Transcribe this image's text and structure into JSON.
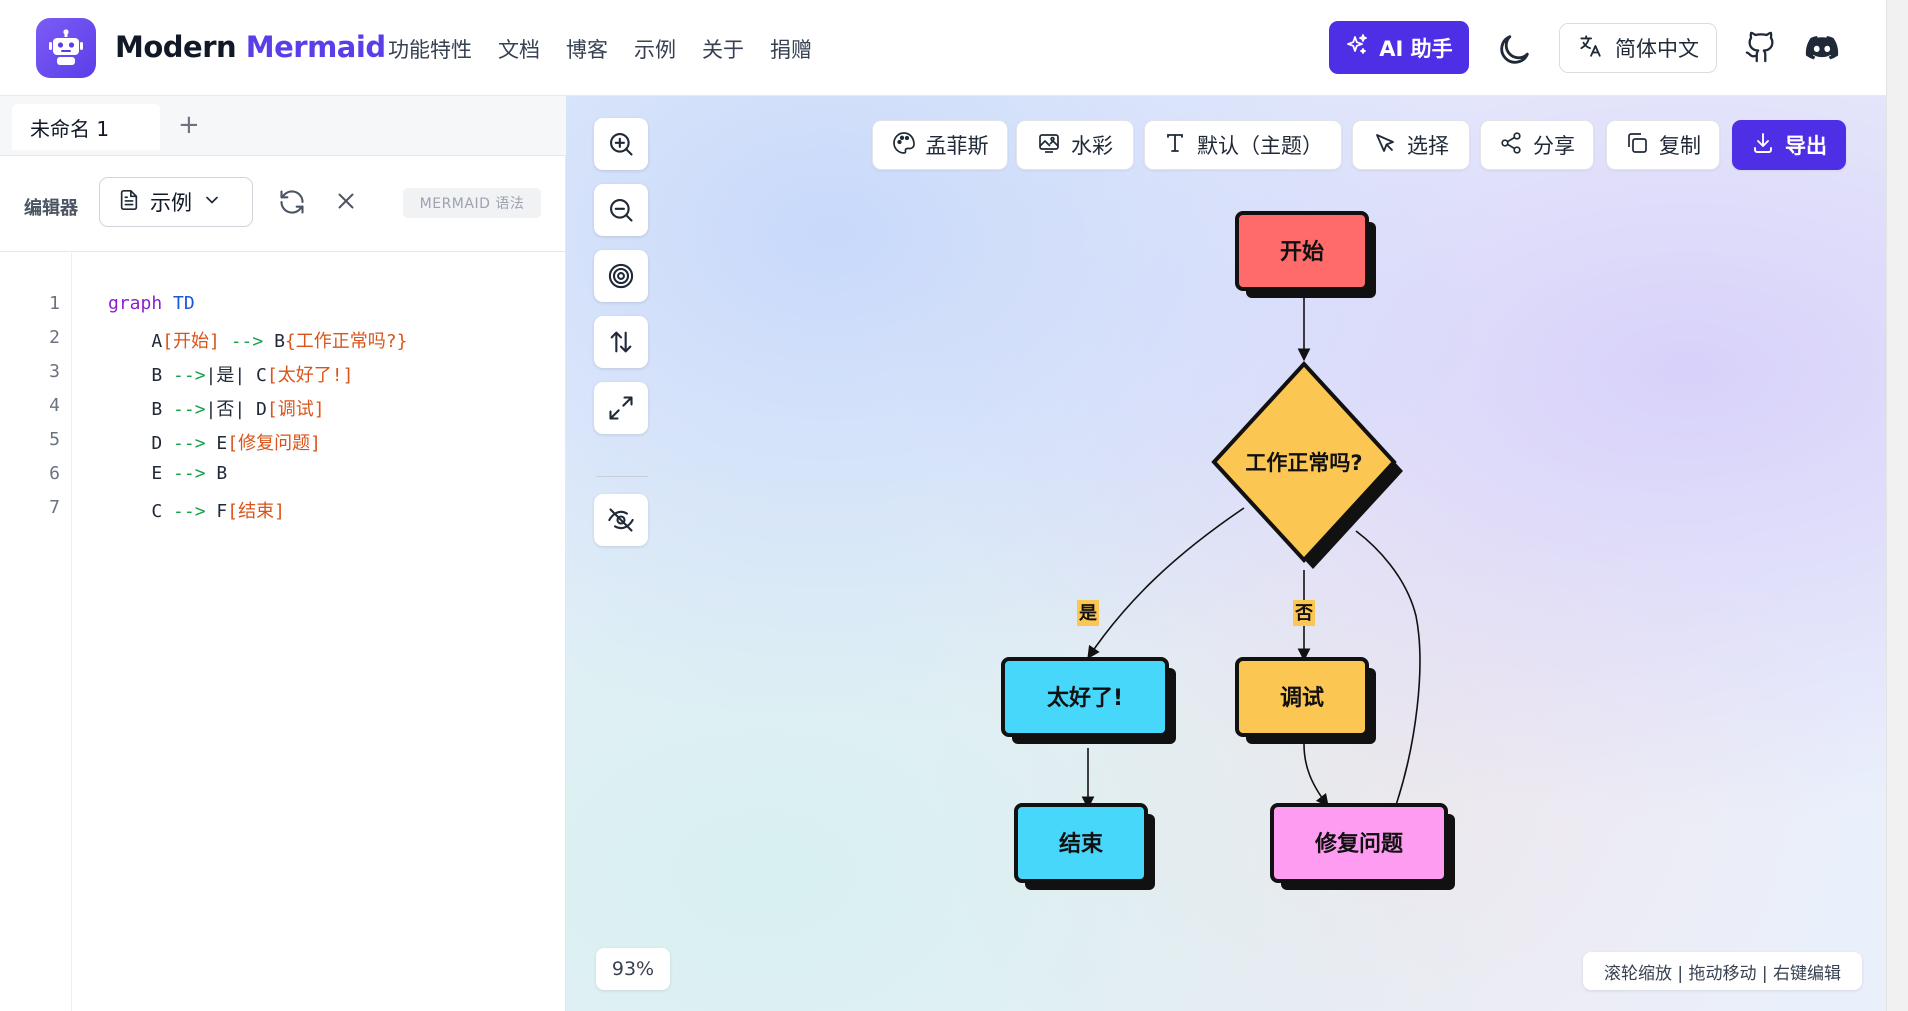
{
  "header": {
    "brand_part1": "Modern",
    "brand_part2": "Mermaid",
    "nav": [
      "功能特性",
      "文档",
      "博客",
      "示例",
      "关于",
      "捐赠"
    ],
    "ai_button": "AI 助手",
    "language_button": "简体中文",
    "icons": [
      "robot-logo-icon",
      "sparkles-icon",
      "moon-icon",
      "translate-icon",
      "github-icon",
      "discord-icon"
    ]
  },
  "editor": {
    "tab_label": "未命名 1",
    "add_tab": "+",
    "label": "编辑器",
    "example_select": "示例",
    "syntax_badge": "MERMAID 语法",
    "line_numbers": [
      "1",
      "2",
      "3",
      "4",
      "5",
      "6",
      "7"
    ],
    "code": [
      [
        {
          "t": "graph",
          "c": "kw"
        },
        {
          "t": " "
        },
        {
          "t": "TD",
          "c": "kw2"
        }
      ],
      [
        {
          "t": "    A"
        },
        {
          "t": "[开始]",
          "c": "str"
        },
        {
          "t": " "
        },
        {
          "t": "-->",
          "c": "arr"
        },
        {
          "t": " B"
        },
        {
          "t": "{工作正常吗?}",
          "c": "str"
        }
      ],
      [
        {
          "t": "    B "
        },
        {
          "t": "-->",
          "c": "arr"
        },
        {
          "t": "|是| C"
        },
        {
          "t": "[太好了!]",
          "c": "str"
        }
      ],
      [
        {
          "t": "    B "
        },
        {
          "t": "-->",
          "c": "arr"
        },
        {
          "t": "|否| D"
        },
        {
          "t": "[调试]",
          "c": "str"
        }
      ],
      [
        {
          "t": "    D "
        },
        {
          "t": "-->",
          "c": "arr"
        },
        {
          "t": " E"
        },
        {
          "t": "[修复问题]",
          "c": "str"
        }
      ],
      [
        {
          "t": "    E "
        },
        {
          "t": "-->",
          "c": "arr"
        },
        {
          "t": " B"
        }
      ],
      [
        {
          "t": "    C "
        },
        {
          "t": "-->",
          "c": "arr"
        },
        {
          "t": " F"
        },
        {
          "t": "[结束]",
          "c": "str"
        }
      ]
    ]
  },
  "canvas": {
    "toolbar": {
      "style_button": "孟菲斯",
      "watermark_button": "水彩",
      "font_button": "默认（主题）",
      "select_button": "选择",
      "share_button": "分享",
      "copy_button": "复制",
      "export_button": "导出"
    },
    "side_tools": [
      "zoom-in-icon",
      "zoom-out-icon",
      "target-icon",
      "swap-vertical-icon",
      "maximize-icon",
      "eye-off-icon"
    ],
    "zoom_level": "93%",
    "hint": "滚轮缩放 | 拖动移动 | 右键编辑"
  },
  "diagram": {
    "nodes": {
      "A": {
        "label": "开始",
        "color": "#ff6b6b"
      },
      "B": {
        "label": "工作正常吗?",
        "color": "#fcc652"
      },
      "C": {
        "label": "太好了!",
        "color": "#47d7fa"
      },
      "D": {
        "label": "调试",
        "color": "#fcc652"
      },
      "E": {
        "label": "修复问题",
        "color": "#fd9cf0"
      },
      "F": {
        "label": "结束",
        "color": "#47d7fa"
      }
    },
    "edge_labels": {
      "yes": "是",
      "no": "否"
    }
  }
}
